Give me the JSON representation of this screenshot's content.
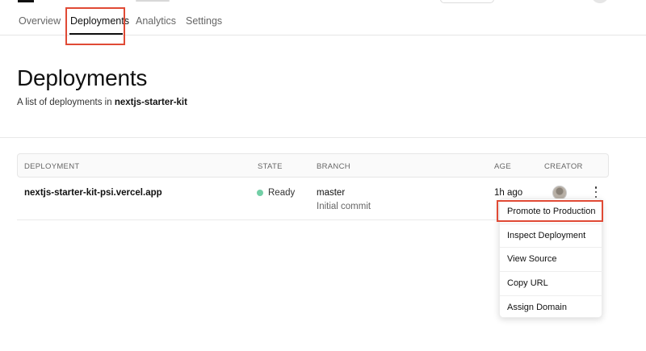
{
  "nav": {
    "tabs": [
      {
        "label": "Overview",
        "active": false
      },
      {
        "label": "Deployments",
        "active": true
      },
      {
        "label": "Analytics",
        "active": false
      },
      {
        "label": "Settings",
        "active": false
      }
    ]
  },
  "header": {
    "title": "Deployments",
    "subtitle_prefix": "A list of deployments in",
    "project_name": "nextjs-starter-kit"
  },
  "table": {
    "columns": [
      "DEPLOYMENT",
      "STATE",
      "BRANCH",
      "AGE",
      "CREATOR"
    ],
    "rows": [
      {
        "deployment": "nextjs-starter-kit-psi.vercel.app",
        "state": "Ready",
        "branch": "master",
        "commit": "Initial commit",
        "age": "1h ago"
      }
    ]
  },
  "menu": {
    "items": [
      "Promote to Production",
      "Inspect Deployment",
      "View Source",
      "Copy URL",
      "Assign Domain"
    ]
  },
  "colors": {
    "highlight": "#e04a35",
    "ready": "#72cfa6"
  },
  "icons": {
    "kebab": "more-vertical-icon",
    "status": "status-dot-icon"
  }
}
